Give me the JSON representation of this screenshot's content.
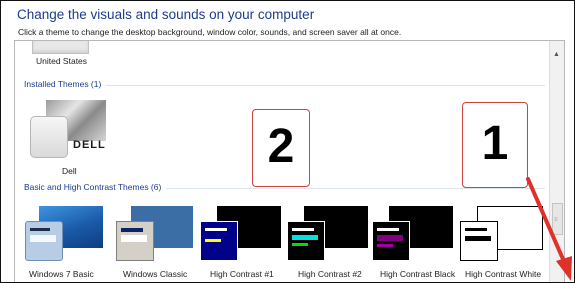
{
  "header": {
    "title": "Change the visuals and sounds on your computer",
    "subtitle": "Click a theme to change the desktop background, window color, sounds, and screen saver all at once."
  },
  "my_themes": {
    "partial_label": "United States"
  },
  "installed": {
    "group_label": "Installed Themes (1)",
    "theme_label": "Dell",
    "logo_text": "DELL"
  },
  "basic": {
    "group_label": "Basic and High Contrast Themes (6)",
    "themes": [
      {
        "label": "Windows 7 Basic"
      },
      {
        "label": "Windows Classic"
      },
      {
        "label": "High Contrast #1"
      },
      {
        "label": "High Contrast #2"
      },
      {
        "label": "High Contrast Black"
      },
      {
        "label": "High Contrast White"
      }
    ]
  },
  "annotations": {
    "box_1": "1",
    "box_2": "2"
  },
  "colors": {
    "heading": "#1e3c8c",
    "annotation_border": "#c8443c",
    "arrow": "#e0302a"
  }
}
